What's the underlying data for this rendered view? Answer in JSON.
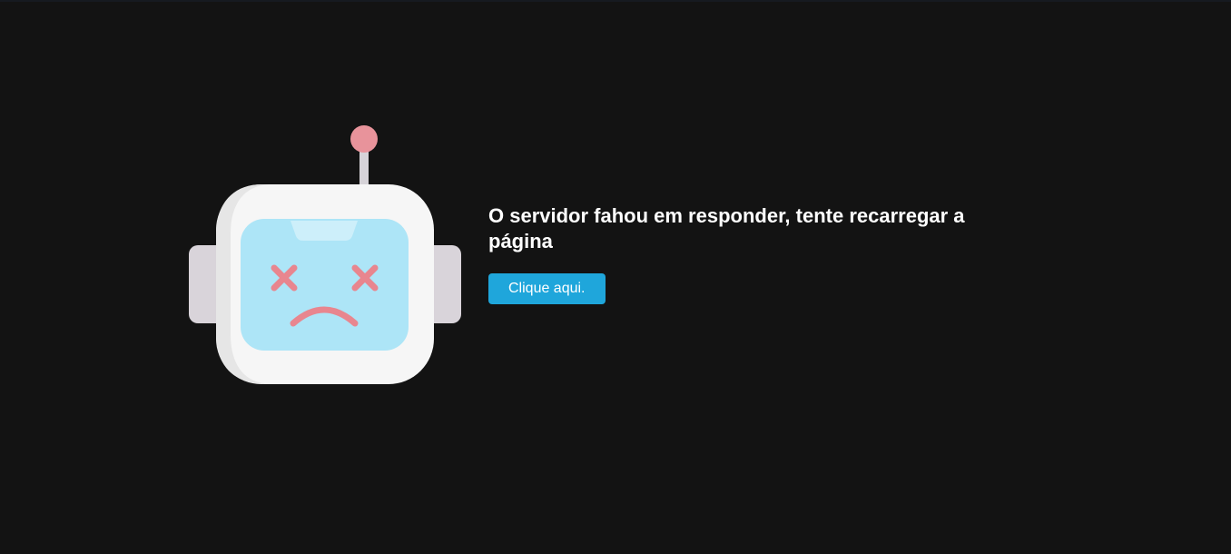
{
  "error": {
    "message": "O servidor fahou em responder, tente recarregar a página",
    "button_label": "Clique aqui."
  },
  "illustration": {
    "icon": "sad-robot-icon",
    "colors": {
      "antenna_ball": "#e8939b",
      "head": "#f6f6f6",
      "ears": "#d9d4da",
      "face": "#ade5f7",
      "features": "#e8868f"
    }
  },
  "theme": {
    "background": "#131313",
    "button": "#1fa6db",
    "text": "#ffffff"
  }
}
